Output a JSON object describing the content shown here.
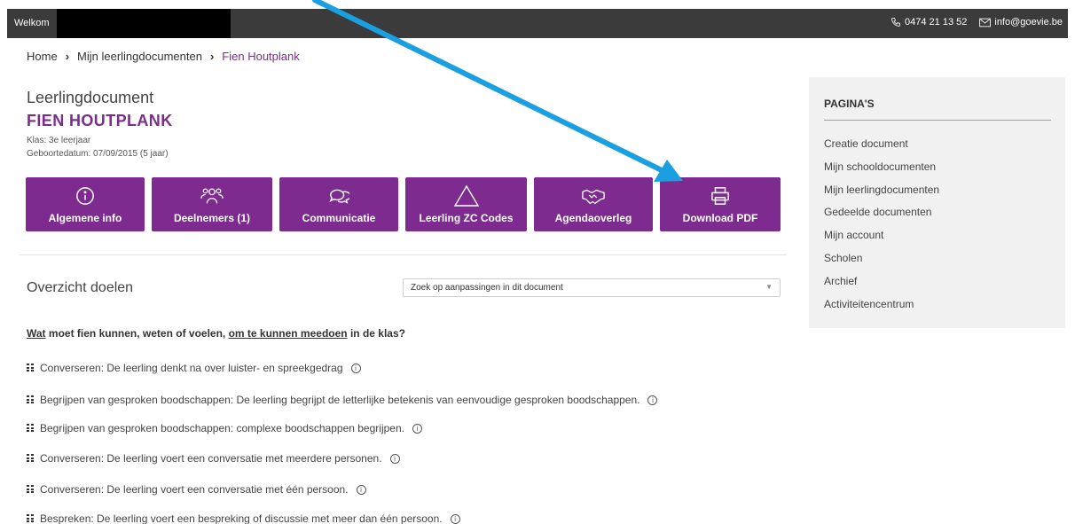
{
  "topbar": {
    "welcome": "Welkom",
    "phone": "0474 21 13 52",
    "email": "info@goevie.be"
  },
  "breadcrumb": {
    "items": [
      "Home",
      "Mijn leerlingdocumenten",
      "Fien Houtplank"
    ]
  },
  "header": {
    "doc_label": "Leerlingdocument",
    "student_name": "FIEN HOUTPLANK",
    "klas": "Klas: 3e leerjaar",
    "birth": "Geboortedatum: 07/09/2015 (5 jaar)"
  },
  "actions": [
    {
      "label": "Algemene info",
      "icon": "info-icon"
    },
    {
      "label": "Deelnemers (1)",
      "icon": "people-icon"
    },
    {
      "label": "Communicatie",
      "icon": "chat-icon"
    },
    {
      "label": "Leerling ZC Codes",
      "icon": "triangle-icon"
    },
    {
      "label": "Agendaoverleg",
      "icon": "handshake-icon"
    },
    {
      "label": "Download PDF",
      "icon": "printer-icon"
    }
  ],
  "overview": {
    "title": "Overzicht doelen",
    "search_placeholder": "Zoek op aanpassingen in dit document",
    "question_parts": [
      "Wat",
      " moet fien kunnen, weten of voelen, ",
      "om te kunnen meedoen",
      " in de klas?"
    ],
    "goals": [
      "Converseren: De leerling denkt na over luister- en spreekgedrag",
      "Begrijpen van gesproken boodschappen: De leerling begrijpt de letterlijke betekenis van eenvoudige gesproken boodschappen.",
      "Begrijpen van gesproken boodschappen: complexe boodschappen begrijpen.",
      "Converseren: De leerling voert een conversatie met meerdere personen.",
      "Converseren: De leerling voert een conversatie met één persoon.",
      "Bespreken: De leerling voert een bespreking of discussie met meer dan één persoon."
    ]
  },
  "sidebar": {
    "title": "PAGINA'S",
    "items": [
      "Creatie document",
      "Mijn schooldocumenten",
      "Mijn leerlingdocumenten",
      "Gedeelde documenten",
      "Mijn account",
      "Scholen",
      "Archief",
      "Activiteitencentrum"
    ]
  },
  "colors": {
    "accent": "#7d2b8e",
    "topbar": "#3b3b3b",
    "annotation_arrow": "#1aa0e0"
  }
}
